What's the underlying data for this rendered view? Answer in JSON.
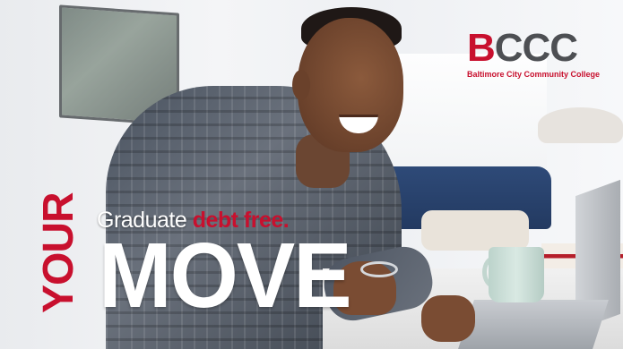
{
  "logo": {
    "letters": [
      "B",
      "CCC"
    ],
    "subtitle": "Baltimore City Community College"
  },
  "slogan": {
    "line1_white": "Graduate",
    "line1_red": "debt free.",
    "vertical": "YOUR",
    "big": "MOVE"
  },
  "colors": {
    "brand_red": "#c8102e",
    "brand_gray": "#4d4f53"
  }
}
